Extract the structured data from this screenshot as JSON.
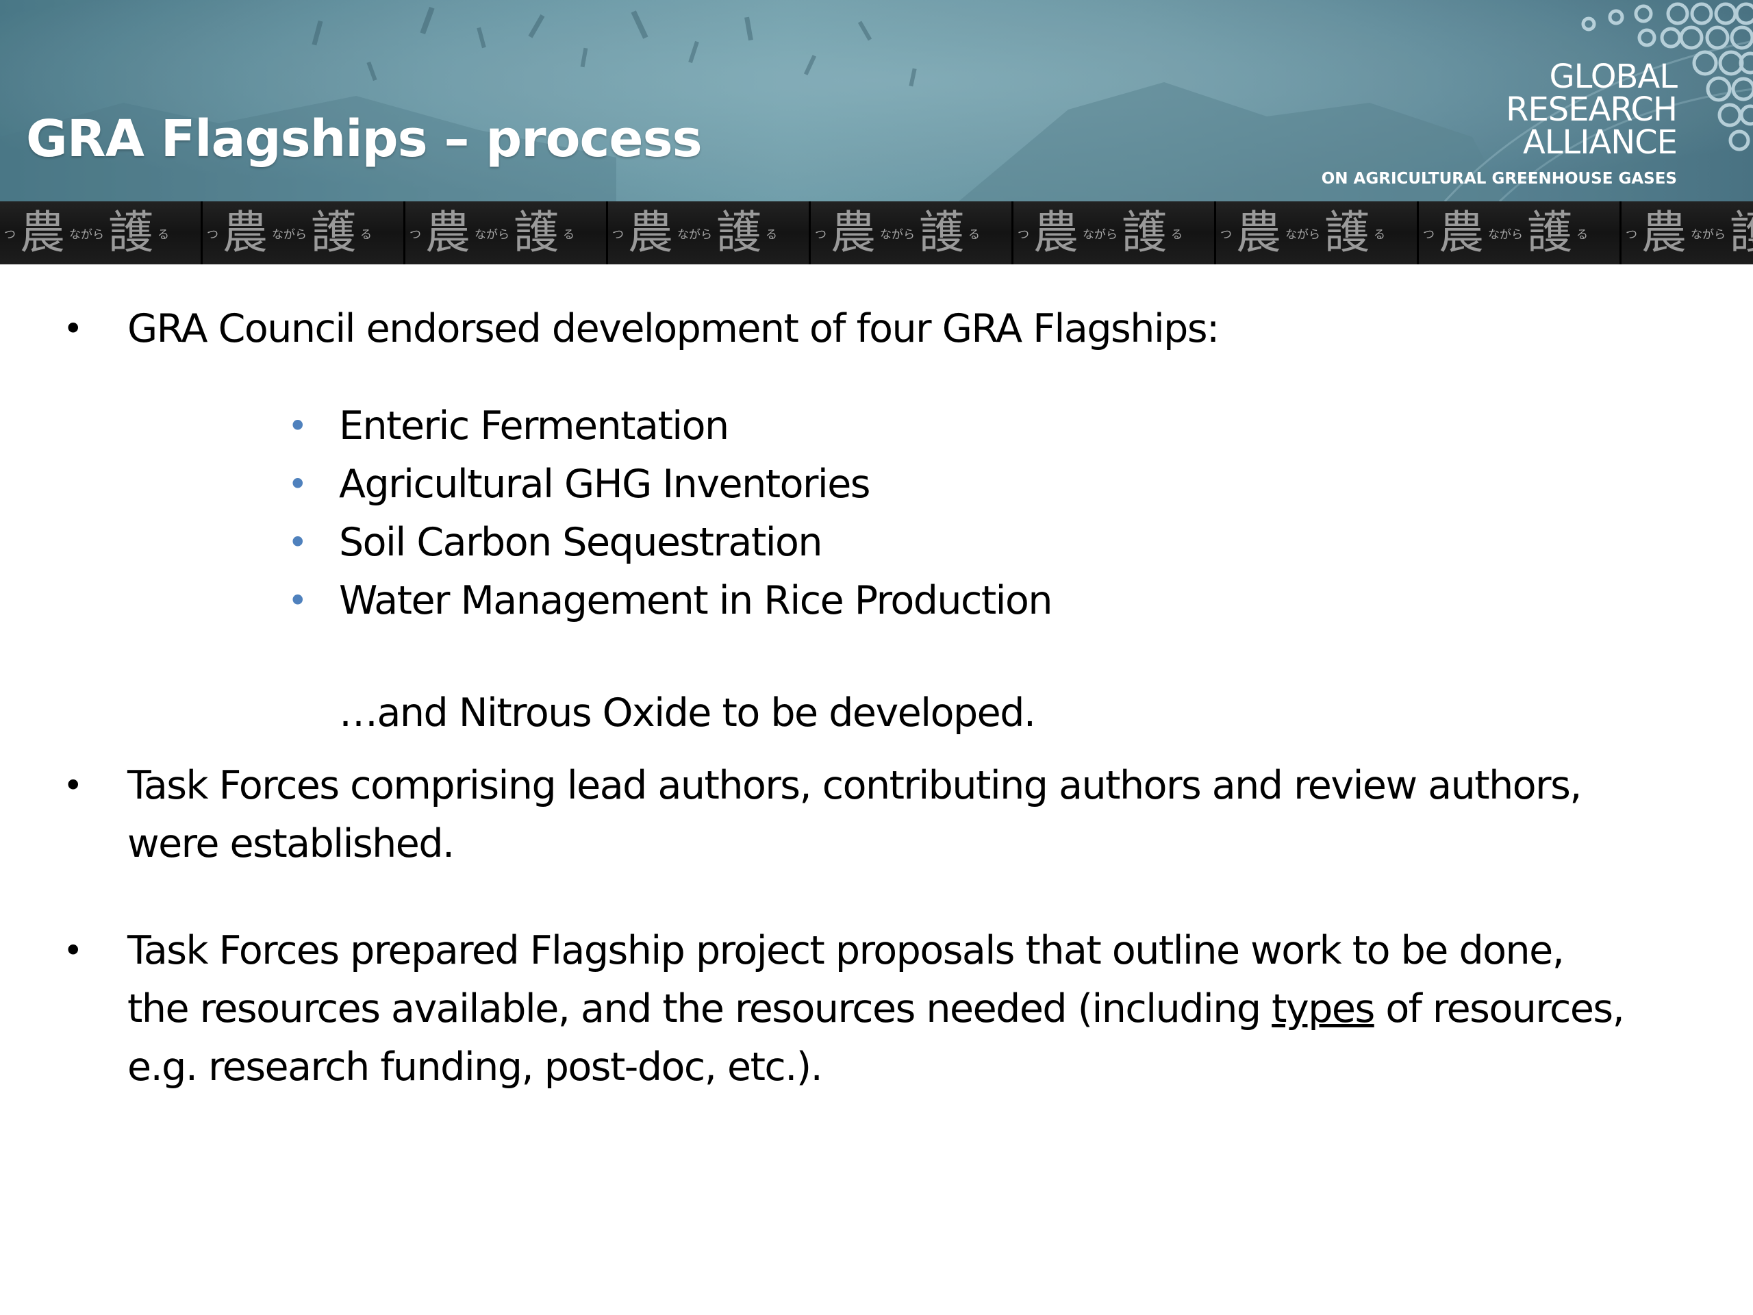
{
  "slide": {
    "title": "GRA Flagships – process"
  },
  "logo": {
    "line1": "GLOBAL",
    "line2": "RESEARCH",
    "line3": "ALLIANCE",
    "subtitle": "ON AGRICULTURAL GREENHOUSE GASES"
  },
  "banner_strip": {
    "kanji_left": "農",
    "kana": "ながら",
    "kanji_right": "護",
    "kana_end": "る",
    "kana_start": "つ"
  },
  "bullets": {
    "b1": "GRA Council endorsed development of four GRA Flagships:",
    "flagships": [
      "Enteric Fermentation",
      "Agricultural GHG Inventories",
      "Soil Carbon Sequestration",
      "Water Management in Rice Production"
    ],
    "nitrous": "…and Nitrous Oxide to be developed.",
    "b2_line1": "Task Forces comprising lead authors, contributing authors and review authors,",
    "b2_line2": "were established.",
    "b3_line1": "Task Forces prepared Flagship project proposals that outline work to be done,",
    "b3_line2_pre": "the resources available, and the resources needed (including ",
    "b3_line2_u": "types",
    "b3_line2_post": " of resources,",
    "b3_line3": "e.g. research funding, post-doc, etc.).",
    "bullet_char": "•"
  },
  "colors": {
    "banner": "#6a98a6",
    "strip": "#151515",
    "sub_bullet": "#4f81bd",
    "text": "#000000"
  }
}
